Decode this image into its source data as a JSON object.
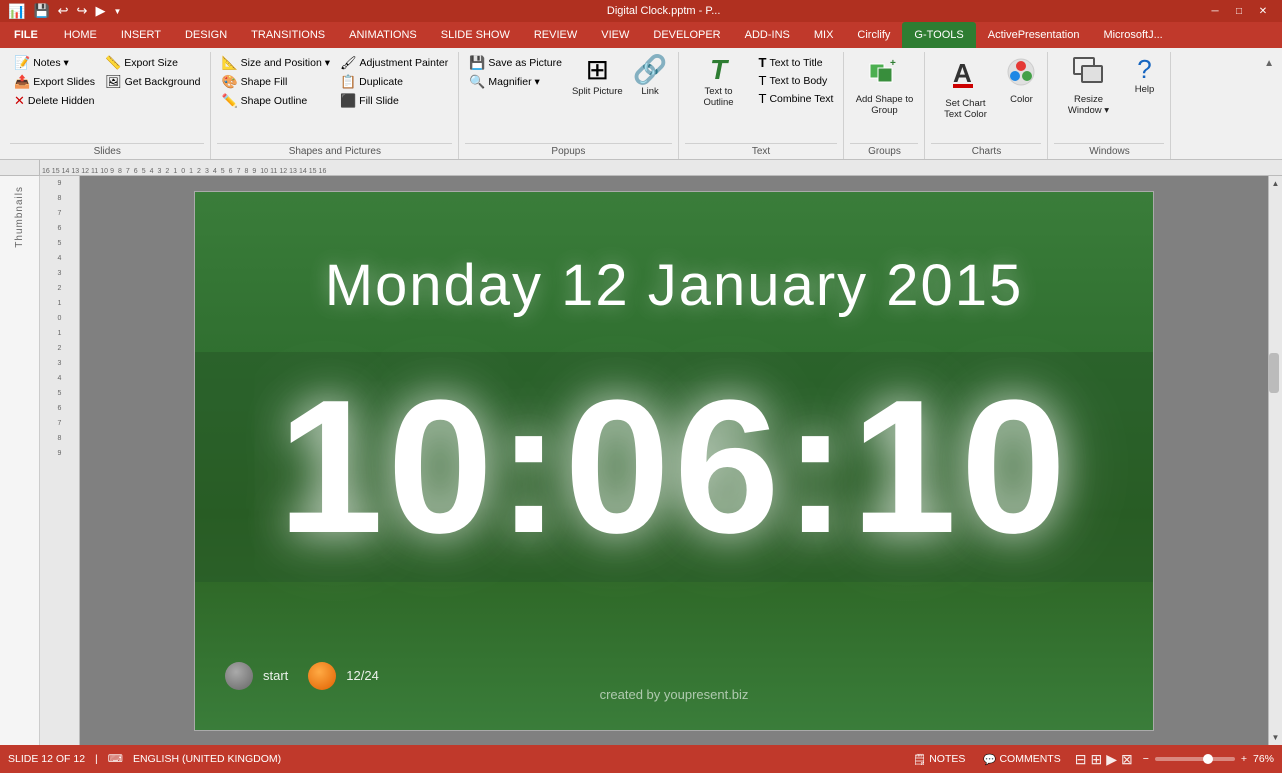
{
  "titleBar": {
    "icon": "📊",
    "title": "Digital Clock.pptm - P...",
    "windowButtons": [
      "─",
      "□",
      "✕"
    ]
  },
  "quickAccess": {
    "icons": [
      "💾",
      "↩",
      "↪",
      "⚡"
    ]
  },
  "ribbonTabs": [
    {
      "id": "file",
      "label": "FILE",
      "isFile": true
    },
    {
      "id": "home",
      "label": "HOME"
    },
    {
      "id": "insert",
      "label": "INSERT"
    },
    {
      "id": "design",
      "label": "DESIGN"
    },
    {
      "id": "transitions",
      "label": "TRANSITIONS"
    },
    {
      "id": "animations",
      "label": "ANIMATIONS"
    },
    {
      "id": "slideshow",
      "label": "SLIDE SHOW"
    },
    {
      "id": "review",
      "label": "REVIEW"
    },
    {
      "id": "view",
      "label": "VIEW"
    },
    {
      "id": "developer",
      "label": "DEVELOPER"
    },
    {
      "id": "addins",
      "label": "ADD-INS"
    },
    {
      "id": "mix",
      "label": "MIX"
    },
    {
      "id": "circlify",
      "label": "Circlify"
    },
    {
      "id": "gtools",
      "label": "G-TOOLS",
      "isActive": true,
      "isGTools": true
    },
    {
      "id": "active",
      "label": "ActivePresentation"
    },
    {
      "id": "microsoft",
      "label": "MicrosoftJ..."
    }
  ],
  "ribbon": {
    "groups": [
      {
        "id": "slides",
        "label": "Slides",
        "items": [
          {
            "type": "small",
            "icon": "📝",
            "label": "Notes ▾"
          },
          {
            "type": "small",
            "icon": "📤",
            "label": "Export Slides"
          },
          {
            "type": "small",
            "icon": "🗑",
            "label": "Delete Hidden"
          }
        ],
        "subItems": [
          {
            "type": "small",
            "icon": "📏",
            "label": "Export Size"
          },
          {
            "type": "small",
            "icon": "🎨",
            "label": "Get Background"
          }
        ]
      },
      {
        "id": "shapes",
        "label": "Shapes and Pictures",
        "items": [
          {
            "type": "small",
            "icon": "📐",
            "label": "Size and Position"
          },
          {
            "type": "small",
            "icon": "🎨",
            "label": "Shape Fill"
          },
          {
            "type": "small",
            "icon": "✏️",
            "label": "Shape Outline"
          }
        ],
        "subItems": [
          {
            "type": "small",
            "icon": "🖌",
            "label": "Adjustment Painter"
          },
          {
            "type": "small",
            "icon": "📋",
            "label": "Duplicate"
          },
          {
            "type": "small",
            "icon": "🖼",
            "label": "Fill Slide"
          }
        ]
      },
      {
        "id": "popups",
        "label": "Popups",
        "items": [
          {
            "type": "big",
            "icon": "✂",
            "label": "Split\nPicture"
          },
          {
            "type": "big",
            "icon": "🔗",
            "label": "Link"
          }
        ],
        "subItems": [
          {
            "type": "small",
            "icon": "💾",
            "label": "Save as Picture"
          },
          {
            "type": "small",
            "icon": "🔍",
            "label": "Magnifier ▾"
          }
        ]
      },
      {
        "id": "text",
        "label": "Text",
        "items": [
          {
            "type": "big",
            "icon": "T",
            "label": "Text to\nOutline"
          },
          {
            "type": "big",
            "icon": "T",
            "label": "Text to\nBody"
          }
        ],
        "subItems": [
          {
            "type": "small",
            "icon": "T",
            "label": "Text to Title"
          },
          {
            "type": "small",
            "icon": "T",
            "label": "Text to Body"
          },
          {
            "type": "small",
            "icon": "T",
            "label": "Combine Text"
          }
        ]
      },
      {
        "id": "groups",
        "label": "Groups",
        "items": [
          {
            "type": "big",
            "icon": "⬛",
            "label": "Add Shape\nto Group"
          }
        ]
      },
      {
        "id": "charts",
        "label": "Charts",
        "items": [
          {
            "type": "big",
            "icon": "A",
            "label": "Set Chart\nText Color"
          },
          {
            "type": "big",
            "icon": "🎨",
            "label": "Color"
          }
        ]
      },
      {
        "id": "windows",
        "label": "Windows",
        "items": [
          {
            "type": "big",
            "icon": "⬜",
            "label": "Resize\nWindow ▾"
          },
          {
            "type": "big",
            "icon": "?",
            "label": "Help"
          }
        ]
      }
    ]
  },
  "slide": {
    "date": "Monday 12 January 2015",
    "time": "10:06:10",
    "credit": "created by youpresent.biz",
    "buttons": [
      {
        "label": "start",
        "color": "gray"
      },
      {
        "label": "12/24",
        "color": "orange"
      }
    ]
  },
  "thumbnails": {
    "label": "Thumbnails"
  },
  "statusBar": {
    "slideInfo": "SLIDE 12 OF 12",
    "language": "ENGLISH (UNITED KINGDOM)",
    "notes": "NOTES",
    "comments": "COMMENTS",
    "zoom": "76%",
    "viewIcons": [
      "⊞",
      "⊟",
      "⊠"
    ]
  }
}
